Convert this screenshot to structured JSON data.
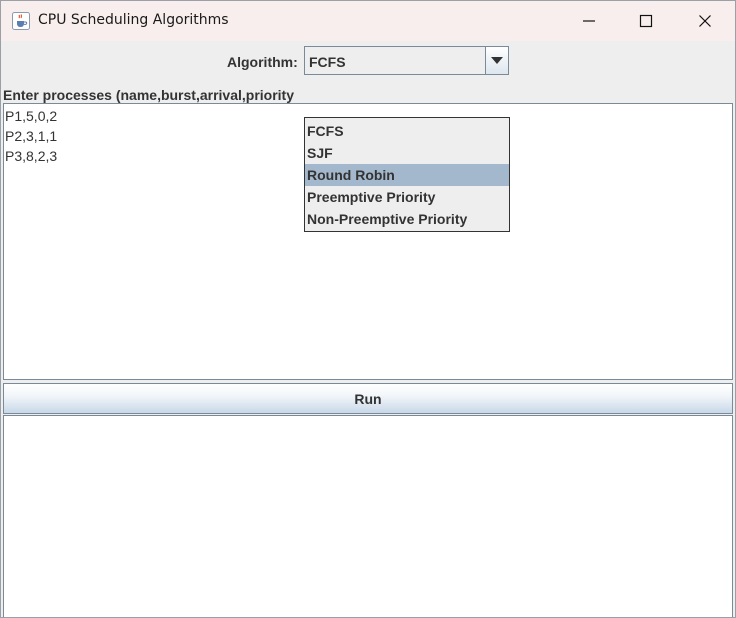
{
  "window": {
    "title": "CPU Scheduling Algorithms"
  },
  "algorithm": {
    "label": "Algorithm:",
    "selected": "FCFS",
    "options": [
      "FCFS",
      "SJF",
      "Round Robin",
      "Preemptive Priority",
      "Non-Preemptive Priority"
    ],
    "highlighted": "Round Robin"
  },
  "input": {
    "label": "Enter processes (name,burst,arrival,priority",
    "lines": [
      "P1,5,0,2",
      "P2,3,1,1",
      "P3,8,2,3"
    ]
  },
  "run": {
    "label": "Run"
  },
  "icons": {
    "app": "java-cup-icon",
    "minimize": "minimize-icon",
    "maximize": "maximize-icon",
    "close": "close-icon",
    "combo_arrow": "chevron-down-icon"
  },
  "colors": {
    "title_bar": "#f9eeee",
    "selection": "#a3b8cc",
    "panel": "#eeeeee"
  }
}
